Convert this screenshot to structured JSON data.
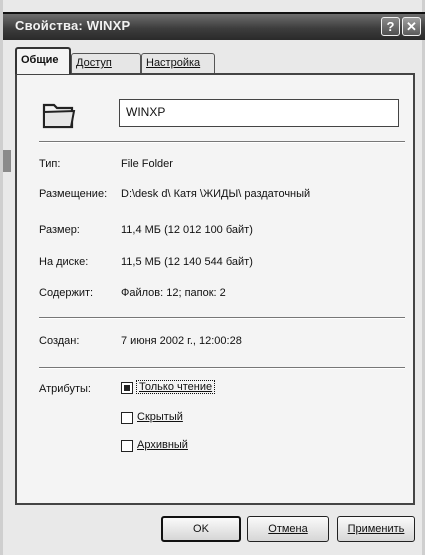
{
  "window": {
    "title": "Свойства: WINXP",
    "help_button": "?",
    "close_button": "✕"
  },
  "tabs": [
    {
      "label": "Общие",
      "active": true
    },
    {
      "label": "Доступ",
      "active": false
    },
    {
      "label": "Настройка",
      "active": false
    }
  ],
  "name_field": {
    "value": "WINXP"
  },
  "properties": {
    "type": {
      "label": "Тип:",
      "value": "File Folder"
    },
    "location": {
      "label": "Размещение:",
      "value": "D:\\desk d\\ Катя \\ЖИДЫ\\ раздаточный"
    },
    "size": {
      "label": "Размер:",
      "value": "11,4 МБ (12 012 100 байт)"
    },
    "size_on_disk": {
      "label": "На диске:",
      "value": "11,5 МБ (12 140 544 байт)"
    },
    "contains": {
      "label": "Содержит:",
      "value": "Файлов: 12; папок: 2"
    },
    "created": {
      "label": "Создан:",
      "value": "7 июня 2002 г., 12:00:28"
    }
  },
  "attributes": {
    "label": "Атрибуты:",
    "items": [
      {
        "label": "Только чтение",
        "checked": true
      },
      {
        "label": "Скрытый",
        "checked": false
      },
      {
        "label": "Архивный",
        "checked": false
      }
    ]
  },
  "buttons": {
    "ok": "OK",
    "cancel": "Отмена",
    "apply": "Применить"
  },
  "icons": {
    "folder": "folder-icon",
    "help": "help-icon",
    "close": "close-icon"
  }
}
